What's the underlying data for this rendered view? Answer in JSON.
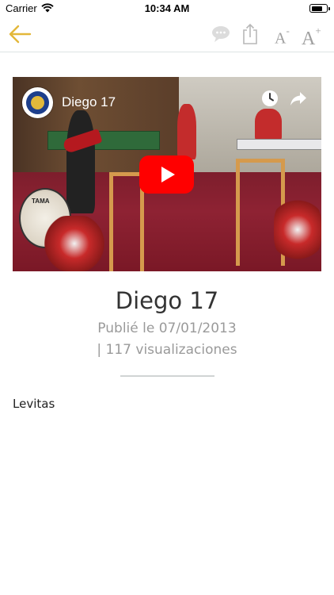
{
  "status_bar": {
    "carrier": "Carrier",
    "time": "10:34 AM",
    "wifi_icon": "wifi-icon",
    "battery_icon": "battery-icon"
  },
  "toolbar": {
    "back_icon": "arrow-left-icon",
    "comment_icon": "comment-icon",
    "share_icon": "share-icon",
    "font_decrease_label": "A",
    "font_decrease_symbol": "-",
    "font_increase_label": "A",
    "font_increase_symbol": "+",
    "accent_color": "#e3b73a"
  },
  "video": {
    "channel_logo_icon": "channel-logo",
    "title": "Diego 17",
    "watch_later_icon": "clock-icon",
    "share_icon": "share-arrow-icon",
    "play_icon": "play-icon",
    "drum_text": "TAMA"
  },
  "post": {
    "title": "Diego 17",
    "published": "Publié le 07/01/2013",
    "views": "| 117 visualizaciones",
    "body": "Levitas"
  }
}
